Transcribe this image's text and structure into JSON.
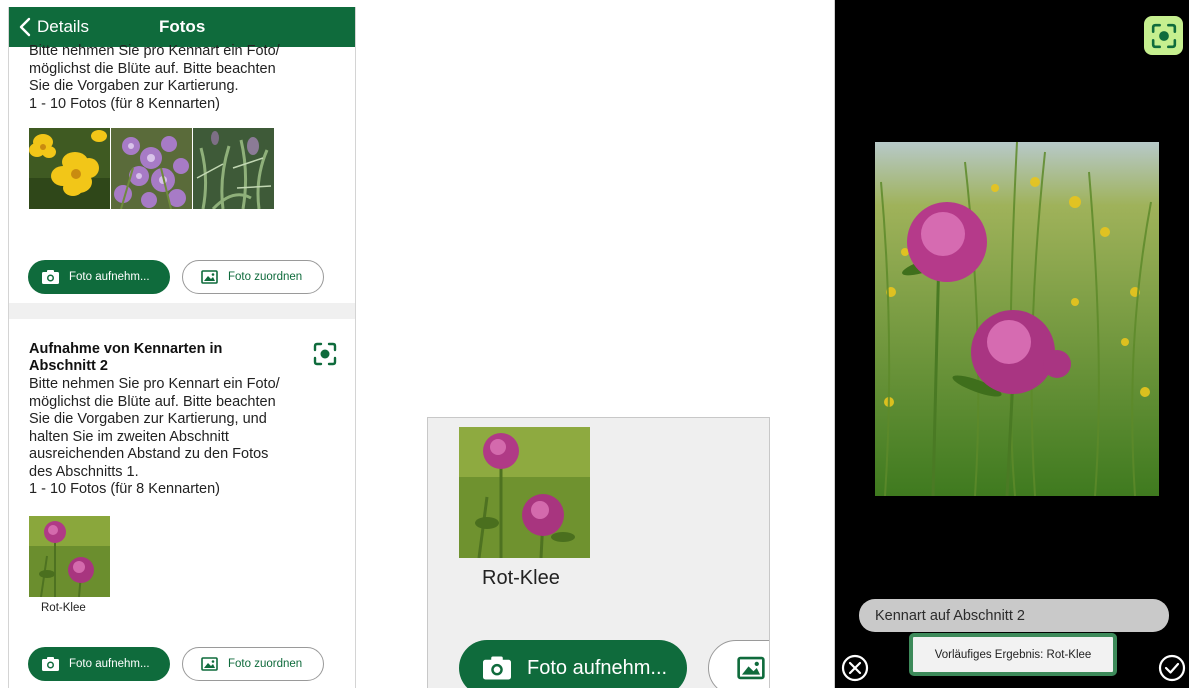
{
  "nav": {
    "back_label": "Details",
    "title": "Fotos"
  },
  "section1": {
    "description_lines": [
      "Bitte nehmen Sie pro Kennart ein Foto/",
      "möglichst die Blüte auf. Bitte beachten",
      "Sie die Vorgaben zur Kartierung.",
      "1 - 10 Fotos (für 8 Kennarten)"
    ],
    "take_photo_label": "Foto aufnehm...",
    "assign_photo_label": "Foto zuordnen"
  },
  "section2": {
    "heading_lines": [
      "Aufnahme von Kennarten in",
      "Abschnitt 2"
    ],
    "description_lines": [
      "Bitte nehmen Sie pro Kennart ein Foto/",
      "möglichst die Blüte auf. Bitte beachten",
      "Sie die Vorgaben zur Kartierung, und",
      "halten Sie im zweiten Abschnitt",
      "ausreichenden Abstand zu den Fotos",
      "des Abschnitts 1.",
      "1 - 10 Fotos (für 8 Kennarten)"
    ],
    "thumb_label": "Rot-Klee",
    "take_photo_label": "Foto aufnehm...",
    "assign_photo_label": "Foto zuordnen"
  },
  "zoom": {
    "thumb_label": "Rot-Klee",
    "take_photo_label": "Foto aufnehm..."
  },
  "camera": {
    "field_text": "Kennart auf Abschnitt 2",
    "result_text": "Vorläufiges Ergebnis: Rot-Klee"
  },
  "colors": {
    "brand_green": "#0f6b3c",
    "scan_button_bg": "#c6ef8f",
    "result_border": "#3d8a5a"
  },
  "icons": {
    "back": "chevron-left-icon",
    "scan": "scan-focus-icon",
    "camera": "camera-icon",
    "gallery": "image-icon",
    "close": "close-circle-icon",
    "confirm": "check-circle-icon"
  }
}
